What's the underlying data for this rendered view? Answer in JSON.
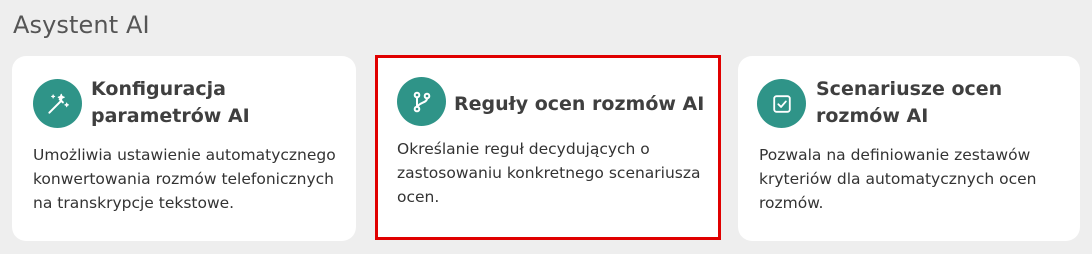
{
  "section": {
    "title": "Asystent AI"
  },
  "cards": [
    {
      "title": "Konfiguracja parametrów AI",
      "description": "Umożliwia ustawienie automatycznego konwertowania rozmów telefonicznych na transkrypcje tekstowe.",
      "icon": "magic-wand-icon"
    },
    {
      "title": "Reguły ocen rozmów AI",
      "description": "Określanie reguł decydujących o zastosowaniu konkretnego scenariusza ocen.",
      "icon": "git-branch-icon"
    },
    {
      "title": "Scenariusze ocen rozmów AI",
      "description": "Pozwala na definiowanie zestawów kryteriów dla automatycznych ocen rozmów.",
      "icon": "checkbox-icon"
    }
  ],
  "colors": {
    "accent": "#2f9488",
    "highlight_border": "#e00000",
    "background": "#eeeeee",
    "card": "#ffffff"
  }
}
